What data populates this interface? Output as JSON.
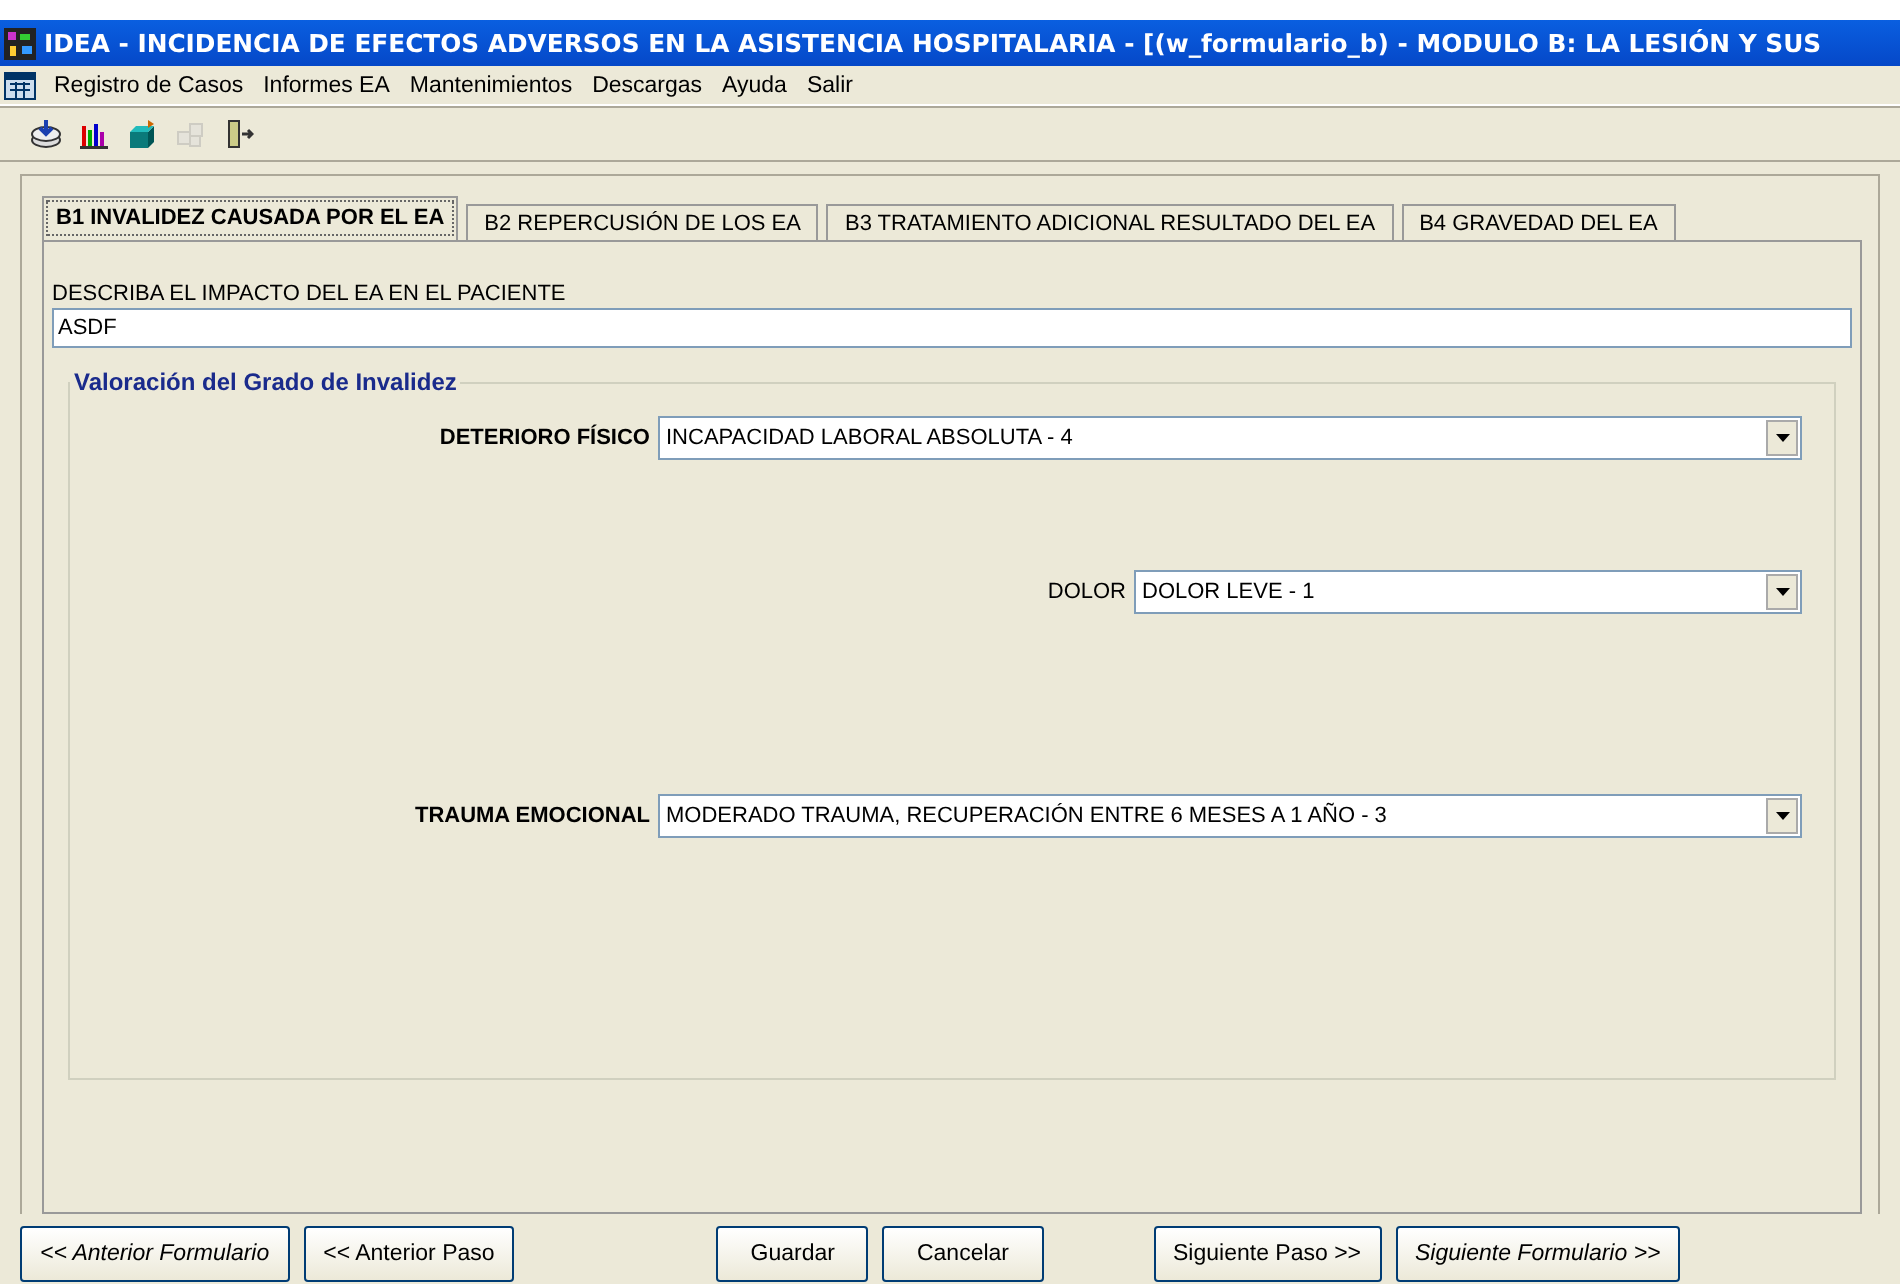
{
  "window": {
    "title": "IDEA - INCIDENCIA DE EFECTOS ADVERSOS EN LA ASISTENCIA HOSPITALARIA - [(w_formulario_b) - MODULO B: LA LESIÓN Y SUS"
  },
  "menu": [
    "Registro de Casos",
    "Informes EA",
    "Mantenimientos",
    "Descargas",
    "Ayuda",
    "Salir"
  ],
  "toolbar": [
    {
      "kind": "download",
      "disabled": false
    },
    {
      "kind": "chart",
      "disabled": false
    },
    {
      "kind": "box",
      "disabled": false
    },
    {
      "kind": "cubes",
      "disabled": true
    },
    {
      "kind": "exit",
      "disabled": false
    }
  ],
  "tabs": [
    {
      "label": "B1 INVALIDEZ CAUSADA POR EL EA",
      "selected": true
    },
    {
      "label": "B2  REPERCUSIÓN DE LOS EA",
      "selected": false
    },
    {
      "label": "B3  TRATAMIENTO ADICIONAL RESULTADO DEL EA",
      "selected": false
    },
    {
      "label": "B4 GRAVEDAD DEL EA",
      "selected": false
    }
  ],
  "impact": {
    "label": "DESCRIBA EL IMPACTO DEL EA EN EL PACIENTE",
    "value": "ASDF"
  },
  "group": {
    "title": "Valoración del Grado de Invalidez",
    "fields": [
      {
        "kind": "wide",
        "label": "DETERIORO FÍSICO",
        "value": "INCAPACIDAD LABORAL ABSOLUTA - 4"
      },
      {
        "kind": "narrow",
        "label": "DOLOR",
        "value": "DOLOR LEVE - 1"
      },
      {
        "kind": "wide",
        "label": "TRAUMA EMOCIONAL",
        "value": "MODERADO TRAUMA, RECUPERACIÓN ENTRE 6 MESES  A 1 AÑO  - 3"
      }
    ]
  },
  "buttons": [
    {
      "label": "<< Anterior Formulario",
      "kind": "form"
    },
    {
      "label": "<< Anterior Paso",
      "kind": "step"
    },
    {
      "label": "Guardar",
      "kind": "action"
    },
    {
      "label": "Cancelar",
      "kind": "action"
    },
    {
      "label": "Siguiente Paso >>",
      "kind": "step"
    },
    {
      "label": "Siguiente Formulario >>",
      "kind": "form"
    }
  ]
}
